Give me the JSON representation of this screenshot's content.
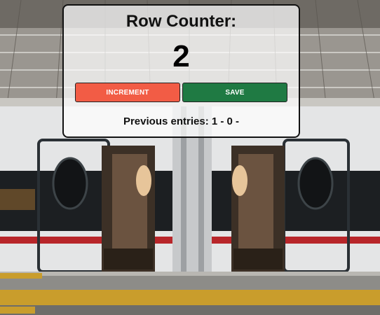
{
  "counter": {
    "title": "Row Counter:",
    "value": "2",
    "increment_label": "INCREMENT",
    "save_label": "SAVE",
    "previous_entries": "Previous entries: 1 - 0 -"
  },
  "colors": {
    "increment_button": "#f25c45",
    "save_button": "#1f7a43",
    "card_border": "#111111"
  }
}
